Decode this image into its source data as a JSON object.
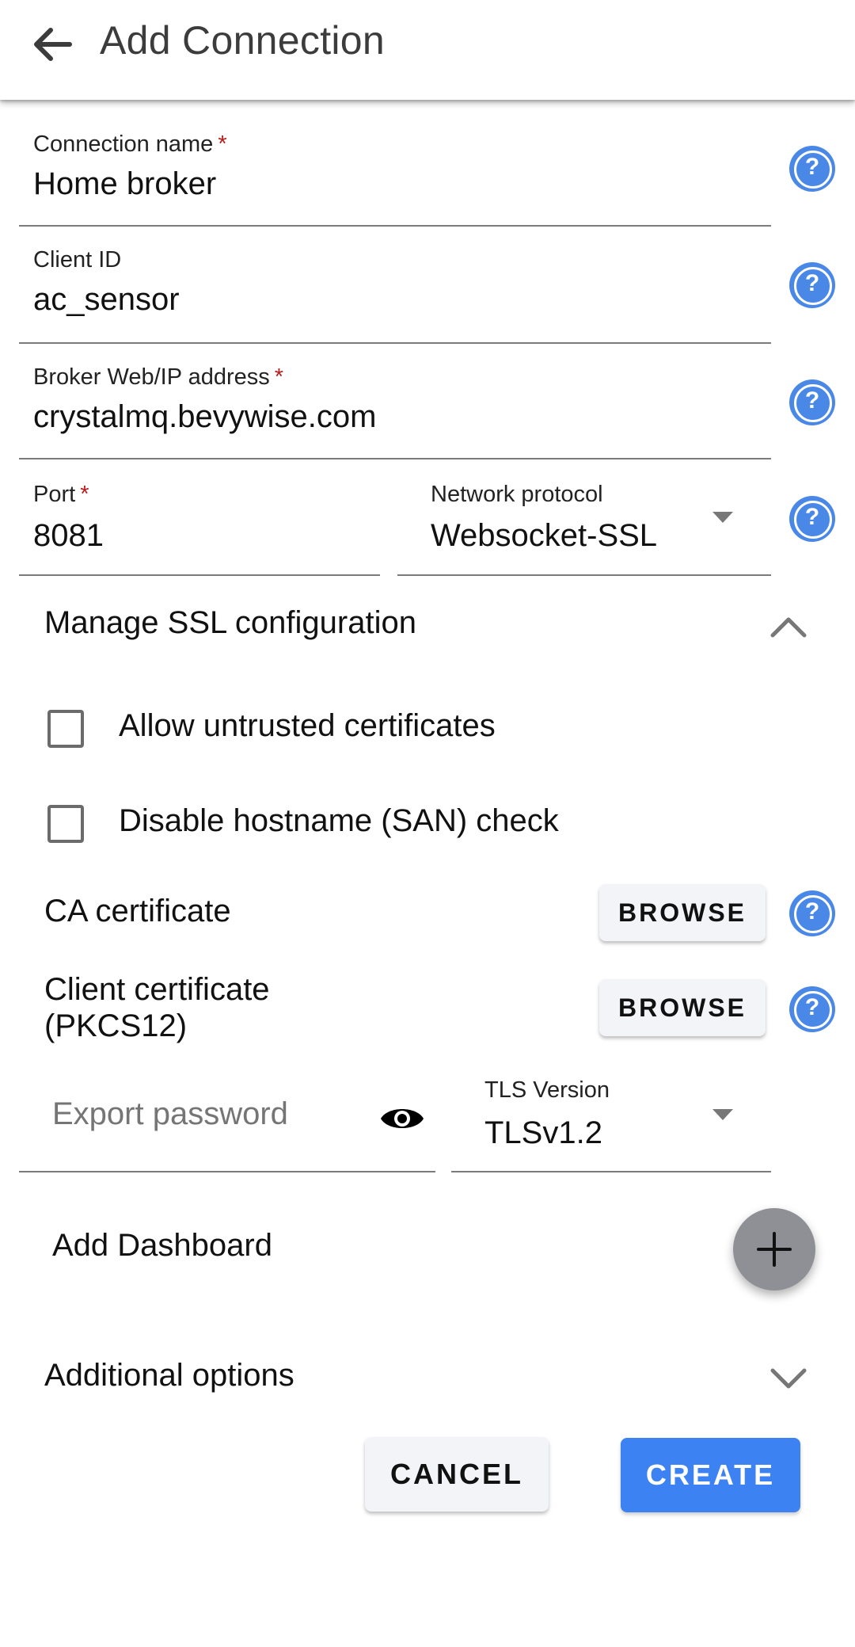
{
  "appbar": {
    "title": "Add Connection",
    "back_icon": "arrow-back-icon"
  },
  "form": {
    "connection_name": {
      "label": "Connection name",
      "required_mark": "*",
      "value": "Home broker",
      "help_icon": "help-circle-icon"
    },
    "client_id": {
      "label": "Client ID",
      "value": "ac_sensor",
      "help_icon": "help-circle-icon"
    },
    "broker_address": {
      "label": "Broker Web/IP address",
      "required_mark": "*",
      "value": "crystalmq.bevywise.com",
      "help_icon": "help-circle-icon"
    },
    "port": {
      "label": "Port",
      "required_mark": "*",
      "value": "8081"
    },
    "network_protocol": {
      "label": "Network protocol",
      "selected": "Websocket-SSL",
      "help_icon": "help-circle-icon"
    }
  },
  "ssl": {
    "title": "Manage SSL configuration",
    "expanded": true,
    "checkboxes": [
      {
        "label": "Allow untrusted certificates",
        "checked": false
      },
      {
        "label": "Disable hostname (SAN) check",
        "checked": false
      }
    ],
    "ca_certificate": {
      "label": "CA certificate",
      "button": "BROWSE"
    },
    "client_certificate": {
      "label_line1": "Client certificate",
      "label_line2": "(PKCS12)",
      "button": "BROWSE"
    },
    "export_password": {
      "placeholder": "Export password",
      "value": "",
      "toggle_icon": "eye-icon"
    },
    "tls_version": {
      "label": "TLS Version",
      "selected": "TLSv1.2"
    }
  },
  "dashboard": {
    "label": "Add Dashboard",
    "fab_icon": "plus-icon"
  },
  "additional_options": {
    "title": "Additional options",
    "expanded": false
  },
  "actions": {
    "cancel": "CANCEL",
    "create": "CREATE"
  },
  "help_glyph": "?",
  "colors": {
    "accent": "#3d82f2",
    "help": "#4a88e8",
    "required": "#b71c1c",
    "fab": "#8e9096"
  }
}
